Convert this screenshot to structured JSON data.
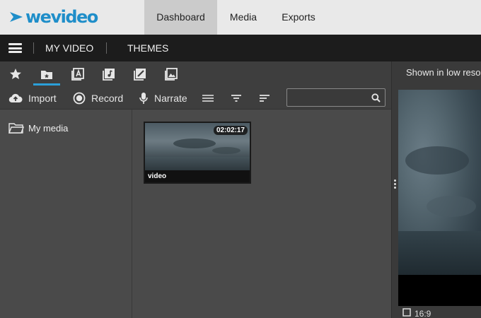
{
  "app": {
    "logo_text": "wevideo",
    "brand_color": "#1f8ec9"
  },
  "topnav": {
    "tabs": [
      {
        "label": "Dashboard",
        "active": true
      },
      {
        "label": "Media",
        "active": false
      },
      {
        "label": "Exports",
        "active": false
      }
    ]
  },
  "secbar": {
    "menu_icon": "hamburger-menu-icon",
    "links": [
      {
        "label": "MY VIDEO"
      },
      {
        "label": "THEMES"
      }
    ]
  },
  "media_panel": {
    "category_icons": [
      "star-icon",
      "my-media-folder-icon",
      "text-icon",
      "music-icon",
      "edit-image-icon",
      "images-icon"
    ],
    "active_category": "my-media-folder-icon",
    "toolbar": {
      "import_label": "Import",
      "record_label": "Record",
      "narrate_label": "Narrate",
      "list_view_icon": "list-view-icon",
      "filter_icon": "filter-icon",
      "sort_icon": "sort-icon",
      "search_placeholder": "",
      "search_value": ""
    },
    "folders": [
      {
        "label": "My media",
        "icon": "folder-icon"
      }
    ],
    "items": [
      {
        "label": "video",
        "duration": "02:02:17"
      }
    ]
  },
  "preview": {
    "note": "Shown in low reso",
    "ratio": "16:9"
  }
}
